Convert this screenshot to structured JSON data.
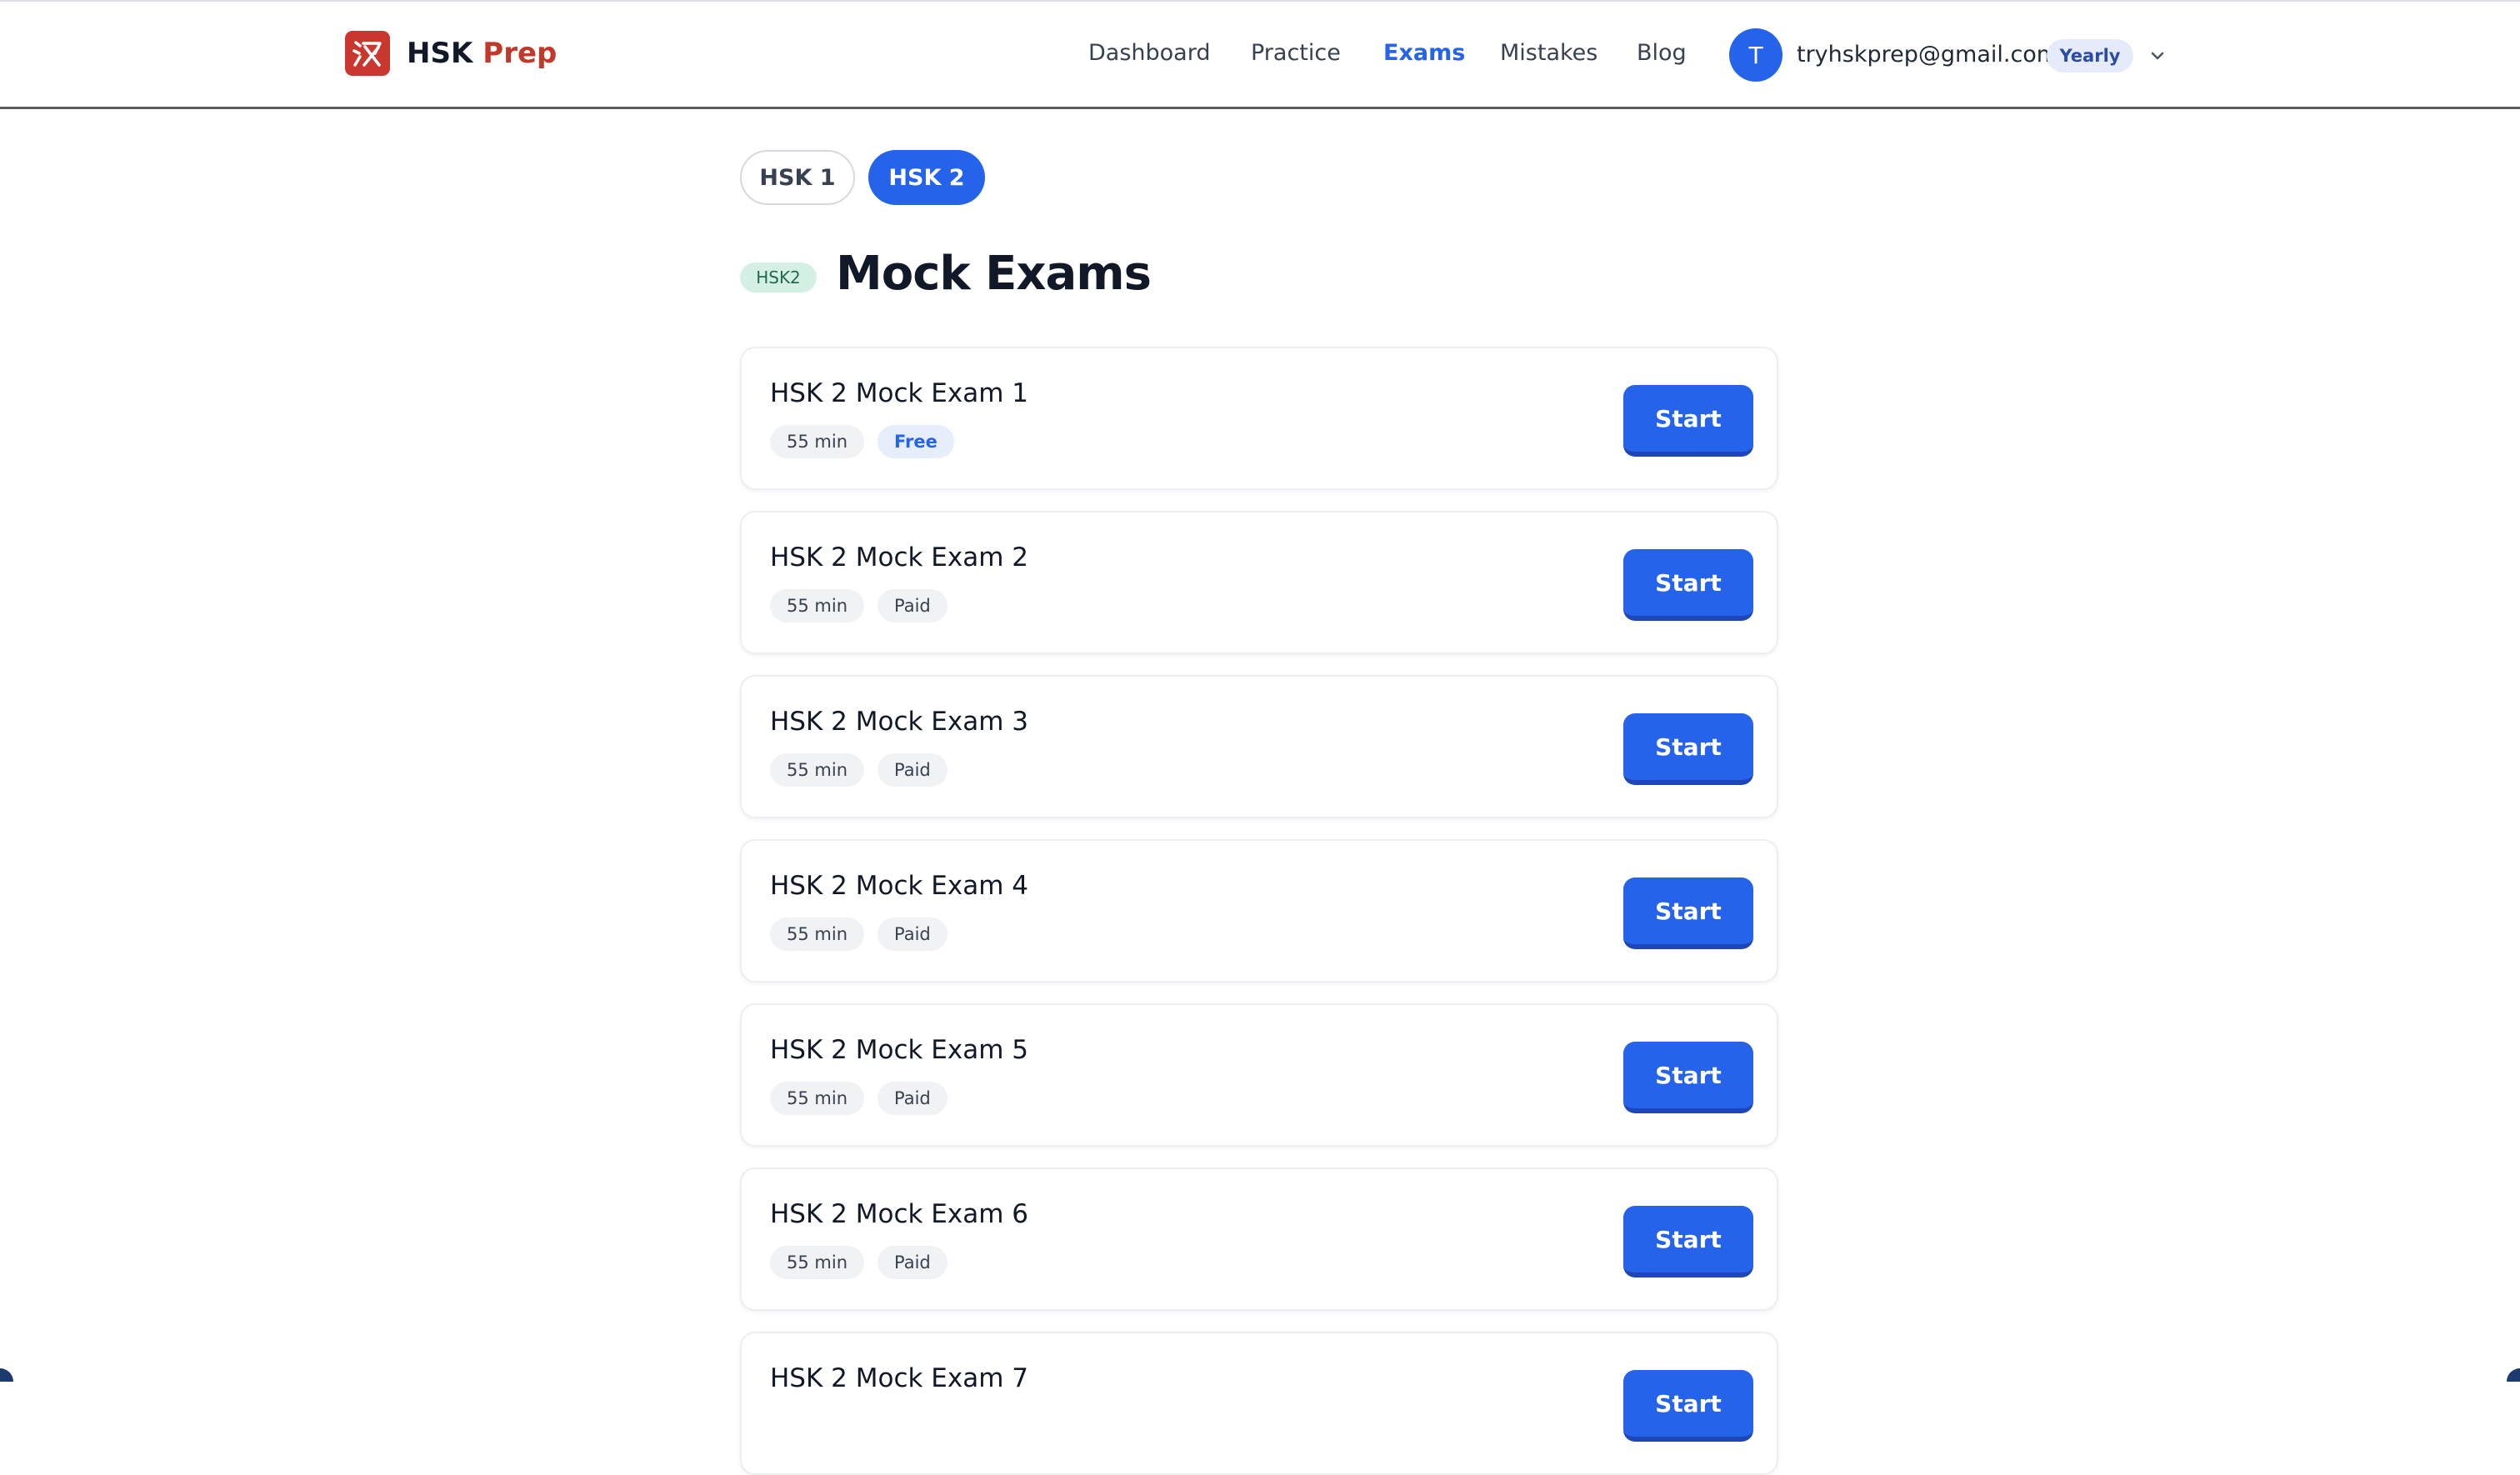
{
  "brand": {
    "logo_char": "汉",
    "name_primary": "HSK",
    "name_accent": "Prep",
    "logo_color": "#c9382f"
  },
  "nav": {
    "items": [
      {
        "label": "Dashboard",
        "active": false
      },
      {
        "label": "Practice",
        "active": false
      },
      {
        "label": "Exams",
        "active": true
      },
      {
        "label": "Mistakes",
        "active": false
      },
      {
        "label": "Blog",
        "active": false
      }
    ]
  },
  "user": {
    "avatar_initial": "T",
    "email": "tryhskprep@gmail.com",
    "plan": "Yearly",
    "menu_icon": "chevron-down-icon"
  },
  "level_tabs": [
    {
      "label": "HSK 1",
      "active": false
    },
    {
      "label": "HSK 2",
      "active": true
    }
  ],
  "page": {
    "badge": "HSK2",
    "title": "Mock Exams"
  },
  "exams": [
    {
      "title": "HSK 2 Mock Exam 1",
      "duration": "55 min",
      "access": "Free",
      "button": "Start"
    },
    {
      "title": "HSK 2 Mock Exam 2",
      "duration": "55 min",
      "access": "Paid",
      "button": "Start"
    },
    {
      "title": "HSK 2 Mock Exam 3",
      "duration": "55 min",
      "access": "Paid",
      "button": "Start"
    },
    {
      "title": "HSK 2 Mock Exam 4",
      "duration": "55 min",
      "access": "Paid",
      "button": "Start"
    },
    {
      "title": "HSK 2 Mock Exam 5",
      "duration": "55 min",
      "access": "Paid",
      "button": "Start"
    },
    {
      "title": "HSK 2 Mock Exam 6",
      "duration": "55 min",
      "access": "Paid",
      "button": "Start"
    },
    {
      "title": "HSK 2 Mock Exam 7",
      "button": "Start"
    }
  ],
  "colors": {
    "accent": "#2563eb",
    "brand_red": "#c0392b",
    "badge_green_bg": "#d4efe4"
  }
}
